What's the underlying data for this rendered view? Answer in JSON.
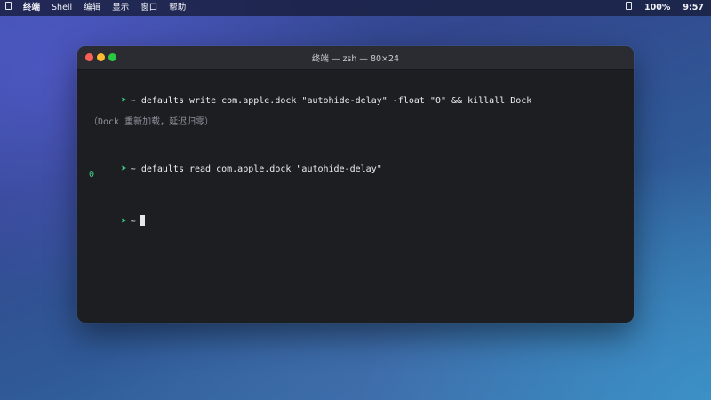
{
  "menubar": {
    "left": [
      "终端",
      "Shell",
      "编辑",
      "显示",
      "窗口",
      "帮助"
    ],
    "battery": "100%",
    "time": "9:57"
  },
  "window": {
    "title": "终端 — zsh — 80×24"
  },
  "terminal": {
    "prompt_symbol": "➤",
    "lines": [
      {
        "prompt": "~",
        "command": "defaults write com.apple.dock \"autohide-delay\" -float \"0\" && killall Dock"
      },
      {
        "note": "（Dock 重新加载，延迟归零）"
      },
      {
        "prompt": "~",
        "command": "defaults read com.apple.dock \"autohide-delay\""
      },
      {
        "output": "0"
      },
      {
        "prompt": "~",
        "command": ""
      }
    ]
  },
  "colors": {
    "prompt": "#3ed48a",
    "terminal_bg": "#1d1e22",
    "titlebar_bg": "#2b2c31"
  }
}
